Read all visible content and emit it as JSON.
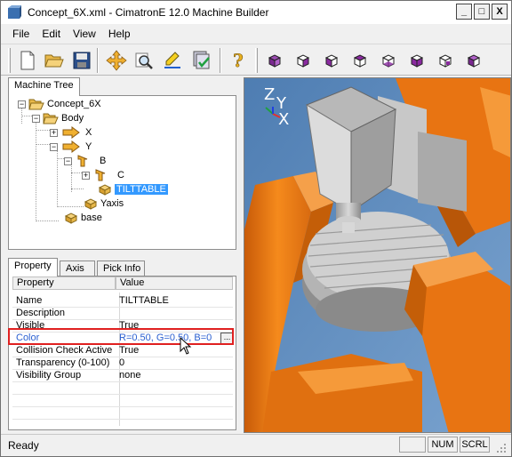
{
  "window": {
    "title": "Concept_6X.xml - CimatronE 12.0 Machine Builder",
    "minimize": "_",
    "maximize": "□",
    "close": "X"
  },
  "menu": [
    "File",
    "Edit",
    "View",
    "Help"
  ],
  "toolbar": {
    "buttons": [
      "new-icon",
      "open-icon",
      "save-icon",
      "move-icon",
      "zoom-icon",
      "edit-icon",
      "check-icon",
      "help-icon",
      "view-cube-1-icon",
      "view-cube-2-icon",
      "view-cube-3-icon",
      "view-cube-4-icon",
      "view-cube-5-icon",
      "view-cube-6-icon",
      "view-cube-7-icon",
      "view-cube-8-icon"
    ]
  },
  "tree_panel": {
    "tab": "Machine Tree",
    "nodes": {
      "root": "Concept_6X",
      "body": "Body",
      "x": "X",
      "y": "Y",
      "b": "B",
      "c": "C",
      "tilttable": "TILTTABLE",
      "yaxis": "Yaxis",
      "base": "base"
    }
  },
  "property_panel": {
    "tabs": [
      "Property",
      "Axis",
      "Pick Info"
    ],
    "columns": [
      "Property",
      "Value"
    ],
    "rows": [
      {
        "name": "Name",
        "value": "TILTTABLE"
      },
      {
        "name": "Description",
        "value": ""
      },
      {
        "name": "Visible",
        "value": "True"
      },
      {
        "name": "Color",
        "value": "R=0.50, G=0.50, B=0"
      },
      {
        "name": "Collision Check Active",
        "value": "True"
      },
      {
        "name": "Transparency (0-100)",
        "value": "0"
      },
      {
        "name": "Visibility Group",
        "value": "none"
      }
    ],
    "ellipsis": "..."
  },
  "viewport": {
    "axis_labels": {
      "z": "Z",
      "y": "Y",
      "x": "X"
    },
    "background": "#5a86b8",
    "accent_orange": "#f07a10"
  },
  "statusbar": {
    "text": "Ready",
    "indicators": [
      "NUM",
      "SCRL"
    ]
  }
}
